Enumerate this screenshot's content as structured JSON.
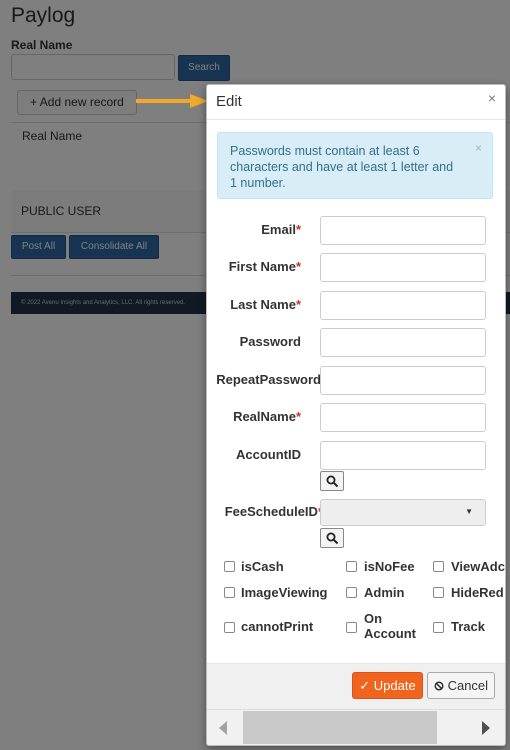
{
  "page": {
    "title": "Paylog",
    "real_name_label": "Real Name",
    "search_label": "Search",
    "add_record_label": "+ Add new record",
    "table_header": "Real Name",
    "row_user": "PUBLIC USER",
    "post_all_label": "Post All",
    "consolidate_all_label": "Consolidate All",
    "footer_text": "© 2022 Avenu Insights and Analytics, LLC. All rights reserved."
  },
  "modal": {
    "title": "Edit",
    "close_glyph": "×",
    "alert_text": "Passwords must contain at least 6 characters and have at least 1 letter and 1 number.",
    "alert_close_glyph": "×",
    "fields": {
      "email": "Email",
      "first_name": "First Name",
      "last_name": "Last Name",
      "password": "Password",
      "repeat_password": "RepeatPassword",
      "real_name": "RealName",
      "account_id": "AccountID",
      "fee_schedule_id": "FeeScheduleID"
    },
    "required_mark": "*",
    "checkboxes": {
      "is_cash": "isCash",
      "is_no_fee": "isNoFee",
      "view_adc": "ViewAdc",
      "image_viewing": "ImageViewing",
      "admin": "Admin",
      "hide_red": "HideRed",
      "cannot_print": "cannotPrint",
      "on_account_line1": "On",
      "on_account_line2": "Account",
      "track": "Track"
    },
    "update_label": "Update",
    "cancel_label": "Cancel",
    "icons": {
      "search": "search-icon",
      "update": "check-icon",
      "cancel": "ban-icon",
      "select": "caret-down-icon"
    },
    "colors": {
      "update_button": "#f0641e",
      "alert_background": "#d9edf7",
      "required": "#c9302c",
      "arrow": "#f0a92a"
    }
  }
}
